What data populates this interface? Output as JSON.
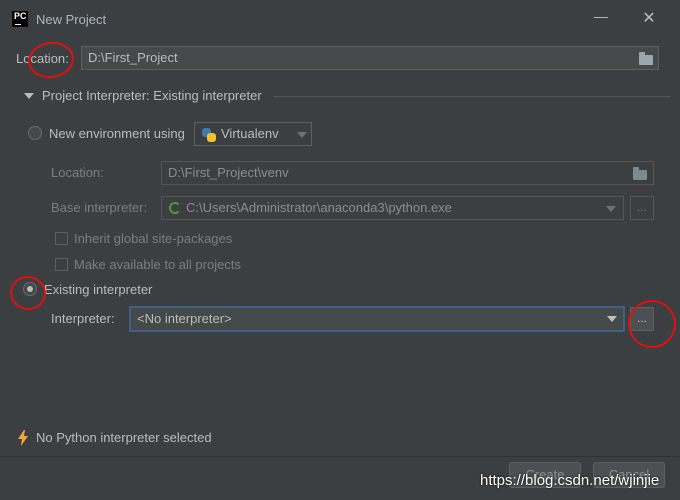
{
  "window": {
    "title": "New Project",
    "minimize_label": "—",
    "close_label": "✕"
  },
  "top_location": {
    "label": "Location:",
    "value": "D:\\First_Project"
  },
  "section": {
    "title": "Project Interpreter: Existing interpreter"
  },
  "new_env": {
    "radio_label": "New environment using",
    "env_type": "Virtualenv",
    "location_label": "Location:",
    "location_value": "D:\\First_Project\\venv",
    "base_interpreter_label": "Base interpreter:",
    "base_interpreter_value": "C:\\Users\\Administrator\\anaconda3\\python.exe",
    "inherit_label": "Inherit global site-packages",
    "available_label": "Make available to all projects",
    "dots_label": "..."
  },
  "existing": {
    "radio_label": "Existing interpreter",
    "interpreter_label": "Interpreter:",
    "interpreter_value": "<No interpreter>",
    "dots_label": "..."
  },
  "status": {
    "message": "No Python interpreter selected"
  },
  "buttons": {
    "create": "Create",
    "cancel": "Cancel"
  },
  "watermark": "https://blog.csdn.net/wjinjie",
  "colors": {
    "background": "#3c3f41",
    "focus_border": "#3d6185",
    "annotation": "#e01010",
    "warning_icon": "#f0a732"
  }
}
